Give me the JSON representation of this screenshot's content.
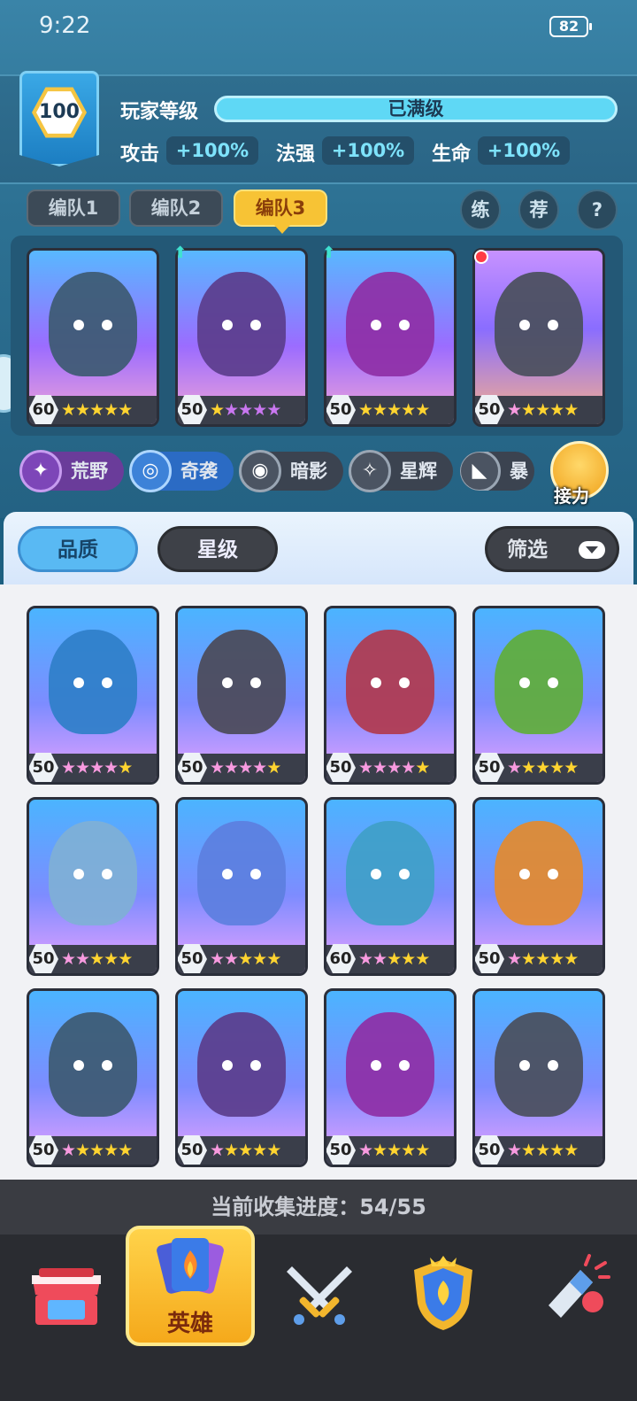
{
  "status": {
    "time": "9:22",
    "battery": "82"
  },
  "player": {
    "level": "100",
    "level_label": "玩家等级",
    "level_status": "已满级",
    "stats": [
      {
        "label": "攻击",
        "value": "+100%"
      },
      {
        "label": "法强",
        "value": "+100%"
      },
      {
        "label": "生命",
        "value": "+100%"
      }
    ]
  },
  "teams": {
    "tabs": [
      "编队1",
      "编队2",
      "编队3"
    ],
    "active": 2
  },
  "round_buttons": [
    "练",
    "荐",
    "?"
  ],
  "team_heroes": [
    {
      "level": "60",
      "stars": [
        "gold",
        "gold",
        "gold",
        "gold",
        "gold"
      ],
      "icon": "horned-demon-icon"
    },
    {
      "level": "50",
      "stars": [
        "gold",
        "purple",
        "purple",
        "purple",
        "purple"
      ],
      "icon": "purple-hair-girl-icon",
      "upgrade": true
    },
    {
      "level": "50",
      "stars": [
        "gold",
        "gold",
        "gold",
        "gold",
        "gold"
      ],
      "icon": "purple-spider-icon",
      "upgrade": true
    },
    {
      "level": "50",
      "stars": [
        "pink",
        "gold",
        "gold",
        "gold",
        "gold"
      ],
      "icon": "mech-robot-icon",
      "notification": true
    }
  ],
  "factions": [
    "荒野",
    "奇袭",
    "暗影",
    "星辉",
    "暴"
  ],
  "relay_label": "接力",
  "filters": {
    "quality": "品质",
    "star": "星级",
    "filter": "筛选"
  },
  "collection": [
    {
      "level": "50",
      "stars": [
        "pink",
        "pink",
        "pink",
        "pink",
        "gold"
      ],
      "icon": "ice-knight-icon"
    },
    {
      "level": "50",
      "stars": [
        "pink",
        "pink",
        "pink",
        "pink",
        "gold"
      ],
      "icon": "wolf-icon"
    },
    {
      "level": "50",
      "stars": [
        "pink",
        "pink",
        "pink",
        "pink",
        "gold"
      ],
      "icon": "red-mech-icon"
    },
    {
      "level": "50",
      "stars": [
        "pink",
        "gold",
        "gold",
        "gold",
        "gold"
      ],
      "icon": "green-dryad-icon"
    },
    {
      "level": "50",
      "stars": [
        "pink",
        "pink",
        "gold",
        "gold",
        "gold"
      ],
      "icon": "polar-bear-icon"
    },
    {
      "level": "50",
      "stars": [
        "pink",
        "pink",
        "gold",
        "gold",
        "gold"
      ],
      "icon": "ice-dragon-icon"
    },
    {
      "level": "60",
      "stars": [
        "pink",
        "pink",
        "gold",
        "gold",
        "gold"
      ],
      "icon": "shark-icon"
    },
    {
      "level": "50",
      "stars": [
        "pink",
        "gold",
        "gold",
        "gold",
        "gold"
      ],
      "icon": "pumpkin-icon"
    },
    {
      "level": "50",
      "stars": [
        "pink",
        "gold",
        "gold",
        "gold",
        "gold"
      ],
      "icon": "monkey-king-icon"
    },
    {
      "level": "50",
      "stars": [
        "pink",
        "gold",
        "gold",
        "gold",
        "gold"
      ],
      "icon": "monk-icon"
    },
    {
      "level": "50",
      "stars": [
        "pink",
        "gold",
        "gold",
        "gold",
        "gold"
      ],
      "icon": "anubis-icon"
    },
    {
      "level": "50",
      "stars": [
        "pink",
        "gold",
        "gold",
        "gold",
        "gold"
      ],
      "icon": "goddess-icon"
    }
  ],
  "progress": "当前收集进度：54/55",
  "nav": {
    "hero_label": "英雄"
  }
}
